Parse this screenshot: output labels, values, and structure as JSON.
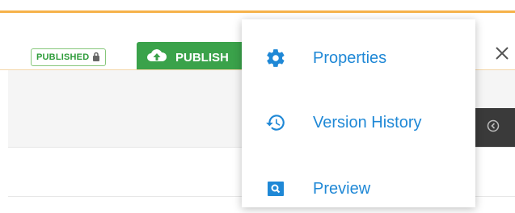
{
  "status_badge": {
    "label": "PUBLISHED"
  },
  "publish_button": {
    "label": "PUBLISH"
  },
  "menu": {
    "items": [
      {
        "label": "Properties",
        "icon": "gear-icon"
      },
      {
        "label": "Version History",
        "icon": "history-icon"
      },
      {
        "label": "Preview",
        "icon": "search-icon"
      }
    ]
  },
  "colors": {
    "accent": "#f6b24a",
    "published_green": "#3aa24a",
    "link_blue": "#1f88d6",
    "panel_dark": "#3a3a3a"
  }
}
